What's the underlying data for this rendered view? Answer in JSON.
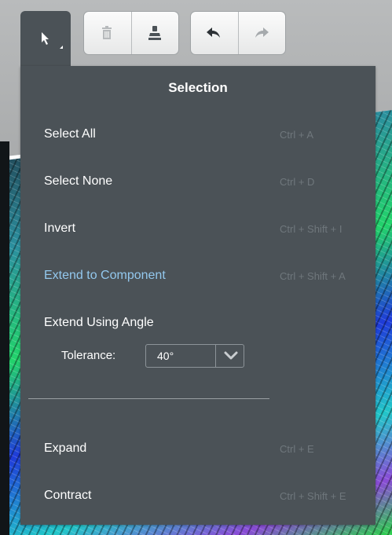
{
  "toolbar": {
    "select_tool": {
      "icon": "cursor-arrow-icon",
      "active": true
    },
    "delete_button": {
      "icon": "trash-icon"
    },
    "flatten_button": {
      "icon": "stamp-icon"
    },
    "undo_button": {
      "icon": "undo-arrow-icon"
    },
    "redo_button": {
      "icon": "redo-arrow-icon",
      "disabled": true
    }
  },
  "menu": {
    "title": "Selection",
    "items": [
      {
        "label": "Select All",
        "shortcut": "Ctrl + A"
      },
      {
        "label": "Select None",
        "shortcut": "Ctrl + D"
      },
      {
        "label": "Invert",
        "shortcut": "Ctrl + Shift + I"
      },
      {
        "label": "Extend to Component",
        "shortcut": "Ctrl + Shift + A",
        "highlighted": true
      },
      {
        "label": "Extend Using Angle",
        "shortcut": ""
      },
      {
        "label": "Expand",
        "shortcut": "Ctrl + E"
      },
      {
        "label": "Contract",
        "shortcut": "Ctrl + Shift + E"
      }
    ],
    "tolerance": {
      "label": "Tolerance:",
      "value": "40°"
    }
  },
  "colors": {
    "panel_bg": "#4b5257",
    "highlight_text": "#93c8ee",
    "shortcut_text": "#6f777c"
  }
}
